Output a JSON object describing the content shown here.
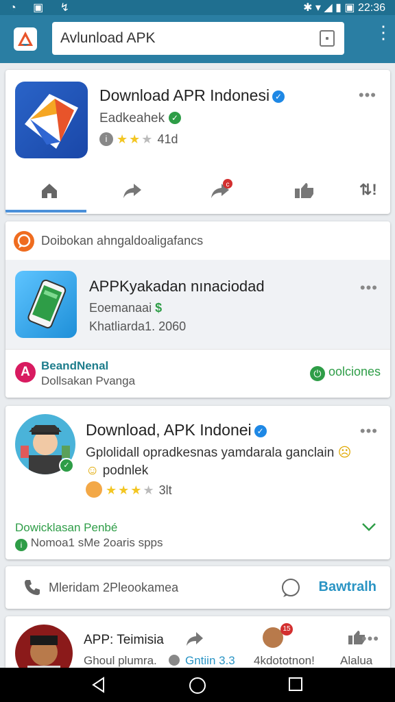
{
  "status_bar": {
    "time": "22:36"
  },
  "search": {
    "value": "Avlunload APK"
  },
  "card1": {
    "title": "Download APR Indonesi",
    "subtitle": "Eadkeahek",
    "rating_text": "41d"
  },
  "card2": {
    "header": "Doibokan ahngaldoaligafancs",
    "app_title": "APPKyakadan nınaciodad",
    "line1": "Eoemanaai",
    "line2": "Khatliarda1. 2060",
    "footer_title": "BeandNenal",
    "footer_sub": "Dollsakan Pvanga",
    "action": "oolciones"
  },
  "card3": {
    "title": "Download, APK Indonei",
    "desc1": "Gplolidall opradkesnas yamdarala ganclain",
    "desc2": "podnlek",
    "rating_text": "3lt",
    "link": "Dowicklasan Penbé",
    "sub": "Nomoa1 sMe 2oaris spps"
  },
  "card4": {
    "label": "Mleridam 2Pleookamea",
    "action": "Bawtralh"
  },
  "card5": {
    "title": "APP: Teimisia",
    "sub1": "Ghoul plumra.",
    "sub2": "Gntiin 3.3",
    "sub3": "4kdototnon!",
    "sub4": "Alalua"
  },
  "colors": {
    "status_bar": "#1f6f90",
    "app_bar": "#2a7ea3",
    "accent_blue": "#1e88e5",
    "accent_green": "#2e9d47",
    "star": "#f3c623"
  }
}
